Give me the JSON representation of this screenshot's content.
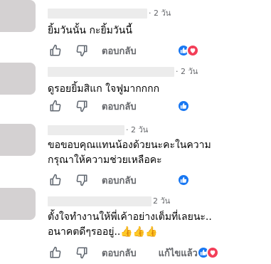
{
  "comments": [
    {
      "time": "· 2 วัน",
      "text": "ยิ้มวันนั้น กะยิ้มวันนี้",
      "reply_label": "ตอบกลับ",
      "reactions": [
        "like",
        "love"
      ]
    },
    {
      "time": "· 2 วัน",
      "text": "ดูรอยยิ้มสิแก ใจฟูมากกกก",
      "reply_label": "ตอบกลับ",
      "reactions": [
        "like"
      ]
    },
    {
      "time": "· 2 วัน",
      "text": "ขอขอบคุณแทนน้องด้วยนะคะในความ\nกรุณาให้ความช่วยเหลือคะ",
      "reply_label": "ตอบกลับ",
      "reactions": [
        "like"
      ]
    },
    {
      "time": "2 วัน",
      "text": "ตั้งใจทำงานให้พี่เค้าอย่างเต็มที่เลยนะ..\nอนาคตดีๆรออยู่..👍👍👍",
      "reply_label": "ตอบกลับ",
      "edited_label": "แก้ไขแล้ว",
      "reactions": [
        "like",
        "love"
      ]
    }
  ],
  "colors": {
    "meta_text": "#65676b",
    "like_blue": "#1877f2",
    "love_red": "#f33e58",
    "avatar_gray": "#d4d1d2"
  },
  "icons": {
    "like_action": "thumbs-up-outline-icon",
    "dislike_action": "thumbs-down-outline-icon",
    "like_reaction": "like-reaction-icon",
    "love_reaction": "love-reaction-icon"
  }
}
